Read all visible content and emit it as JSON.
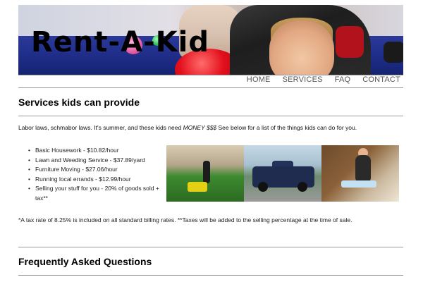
{
  "header": {
    "logo_text": "Rent-A-Kid"
  },
  "nav": {
    "items": [
      {
        "label": "HOME"
      },
      {
        "label": "SERVICES"
      },
      {
        "label": "FAQ"
      },
      {
        "label": "CONTACT"
      }
    ]
  },
  "services_section": {
    "heading": "Services kids can provide",
    "intro_before": "Labor laws, schmabor laws. It's summer, and these kids need ",
    "intro_emphasis": "MONEY $$$",
    "intro_after": " See below for a list of the things kids can do for you.",
    "items": [
      {
        "text": "Basic Housework - $10.82/hour"
      },
      {
        "text": "Lawn and Weeding Service - $37.89/yard"
      },
      {
        "text": "Furniture Moving - $27.06/hour"
      },
      {
        "text": "Running local errands - $12.99/hour"
      },
      {
        "text": "Selling your stuff for you - 20% of goods sold + tax**"
      }
    ],
    "photos": [
      "lawn-mowing-photo",
      "pickup-truck-photo",
      "kid-vacuuming-stairs-photo"
    ],
    "tax_note": "*A tax rate of 8.25% is included on all standard billing rates. **Taxes will be added to the selling percentage at the time of sale."
  },
  "faq_section": {
    "heading": "Frequently Asked Questions"
  },
  "colors": {
    "rule": "#999999",
    "nav_text": "#555555",
    "floor_blue": "#1d2b86",
    "balloon_red": "#e3101c"
  }
}
